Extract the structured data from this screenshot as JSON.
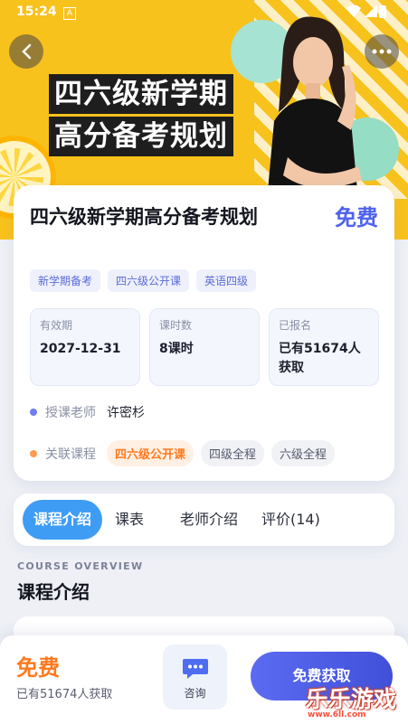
{
  "status_bar": {
    "time": "15:24",
    "notif_icon": "A"
  },
  "hero": {
    "title_line1": "四六级新学期",
    "title_line2": "高分备考规划",
    "bg_color": "#f8c21d"
  },
  "card": {
    "title": "四六级新学期高分备考规划",
    "price": "免费",
    "tags": [
      "新学期备考",
      "四六级公开课",
      "英语四级"
    ],
    "stats": [
      {
        "label": "有效期",
        "value": "2027-12-31"
      },
      {
        "label": "课时数",
        "value": "8课时"
      },
      {
        "label": "已报名",
        "value": "已有51674人获取"
      }
    ],
    "teacher_label": "授课老师",
    "teacher_name": "许密杉",
    "related_label": "关联课程",
    "related": [
      "四六级公开课",
      "四级全程",
      "六级全程"
    ]
  },
  "tabs": [
    "课程介绍",
    "课表",
    "老师介绍",
    "评价(14)"
  ],
  "overview": {
    "en": "COURSE OVERVIEW",
    "cn": "课程介绍"
  },
  "bottom": {
    "price": "免费",
    "count": "已有51674人获取",
    "consult": "咨询",
    "get_button": "免费获取"
  },
  "watermark": {
    "text": "乐乐游戏",
    "url": "www.6ll.com"
  },
  "colors": {
    "accent": "#4f62ee",
    "orange": "#ff7a1f",
    "tab_active": "#3f9cf4"
  }
}
